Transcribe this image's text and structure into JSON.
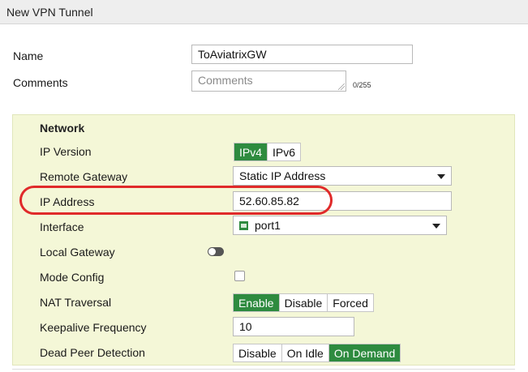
{
  "window": {
    "title": "New VPN Tunnel"
  },
  "general": {
    "name_label": "Name",
    "name_value": "ToAviatrixGW",
    "comments_label": "Comments",
    "comments_placeholder": "Comments",
    "comments_counter": "0/255"
  },
  "network": {
    "section_title": "Network",
    "ip_version": {
      "label": "IP Version",
      "options": [
        "IPv4",
        "IPv6"
      ],
      "selected": "IPv4"
    },
    "remote_gateway": {
      "label": "Remote Gateway",
      "value": "Static IP Address"
    },
    "ip_address": {
      "label": "IP Address",
      "value": "52.60.85.82"
    },
    "interface": {
      "label": "Interface",
      "value": "port1",
      "icon": "port-icon"
    },
    "local_gateway": {
      "label": "Local Gateway",
      "enabled": false
    },
    "mode_config": {
      "label": "Mode Config",
      "checked": false
    },
    "nat_traversal": {
      "label": "NAT Traversal",
      "options": [
        "Enable",
        "Disable",
        "Forced"
      ],
      "selected": "Enable"
    },
    "keepalive": {
      "label": "Keepalive Frequency",
      "value": "10"
    },
    "dead_peer_detection": {
      "label": "Dead Peer Detection",
      "options": [
        "Disable",
        "On Idle",
        "On Demand"
      ],
      "selected": "On Demand"
    }
  },
  "colors": {
    "accent_green": "#2e8b3f",
    "panel_bg": "#f4f7d7",
    "highlight_red": "#e02a2a"
  }
}
